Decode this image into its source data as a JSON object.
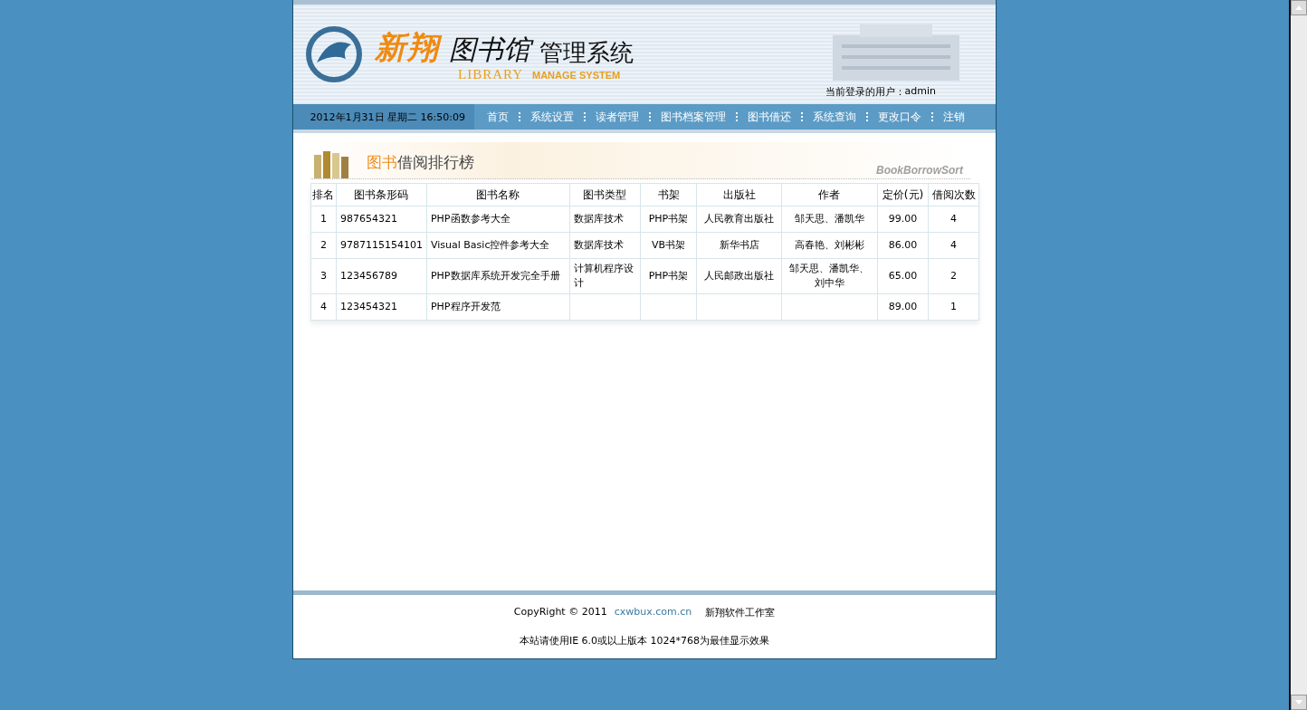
{
  "header": {
    "brand_cn": "新翔",
    "brand_library": "图书馆",
    "brand_system": "管理系统",
    "brand_en_library": "LIBRARY",
    "brand_en_manage": "MANAGE SYSTEM",
    "user_label": "当前登录的用户：",
    "user_name": "admin"
  },
  "nav": {
    "datetime": "2012年1月31日 星期二 16:50:09",
    "items": [
      "首页",
      "系统设置",
      "读者管理",
      "图书档案管理",
      "图书借还",
      "系统查询",
      "更改口令",
      "注销"
    ]
  },
  "section": {
    "title_highlight": "图书",
    "title_rest": "借阅排行榜",
    "subtitle": "BookBorrowSort"
  },
  "table": {
    "columns": [
      "排名",
      "图书条形码",
      "图书名称",
      "图书类型",
      "书架",
      "出版社",
      "作者",
      "定价(元)",
      "借阅次数"
    ],
    "rows": [
      {
        "rank": "1",
        "barcode": "987654321",
        "name": "PHP函数参考大全",
        "type": "数据库技术",
        "shelf": "PHP书架",
        "publisher": "人民教育出版社",
        "author": "邹天思、潘凯华",
        "price": "99.00",
        "count": "4"
      },
      {
        "rank": "2",
        "barcode": "9787115154101",
        "name": "Visual Basic控件参考大全",
        "type": "数据库技术",
        "shelf": "VB书架",
        "publisher": "新华书店",
        "author": "高春艳、刘彬彬",
        "price": "86.00",
        "count": "4"
      },
      {
        "rank": "3",
        "barcode": "123456789",
        "name": "PHP数据库系统开发完全手册",
        "type": "计算机程序设计",
        "shelf": "PHP书架",
        "publisher": "人民邮政出版社",
        "author": "邹天思、潘凯华、刘中华",
        "price": "65.00",
        "count": "2"
      },
      {
        "rank": "4",
        "barcode": "123454321",
        "name": "PHP程序开发范",
        "price": "89.00",
        "count": "1"
      }
    ]
  },
  "footer": {
    "copyright": "CopyRight © 2011",
    "link": "cxwbux.com.cn",
    "studio": "新翔软件工作室",
    "note": "本站请使用IE 6.0或以上版本 1024*768为最佳显示效果"
  }
}
